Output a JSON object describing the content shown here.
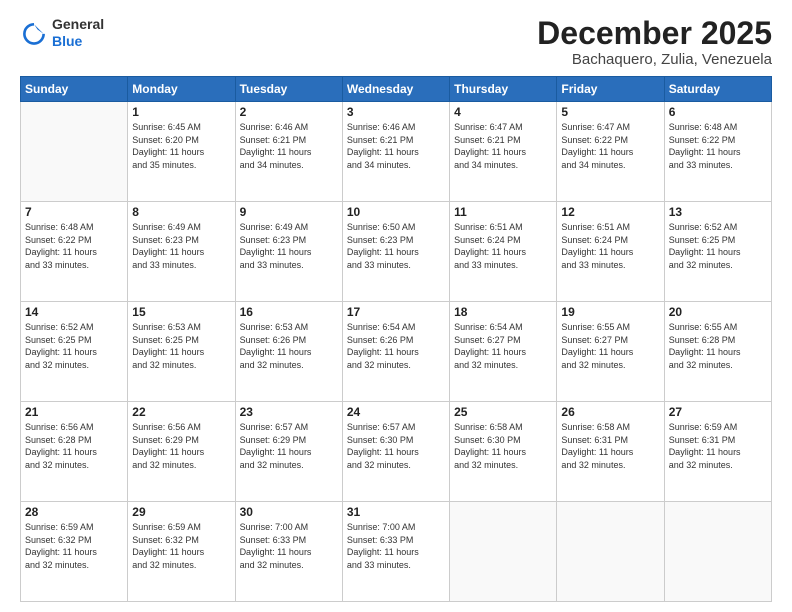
{
  "logo": {
    "general": "General",
    "blue": "Blue"
  },
  "header": {
    "month": "December 2025",
    "location": "Bachaquero, Zulia, Venezuela"
  },
  "weekdays": [
    "Sunday",
    "Monday",
    "Tuesday",
    "Wednesday",
    "Thursday",
    "Friday",
    "Saturday"
  ],
  "weeks": [
    [
      {
        "day": "",
        "text": ""
      },
      {
        "day": "1",
        "text": "Sunrise: 6:45 AM\nSunset: 6:20 PM\nDaylight: 11 hours\nand 35 minutes."
      },
      {
        "day": "2",
        "text": "Sunrise: 6:46 AM\nSunset: 6:21 PM\nDaylight: 11 hours\nand 34 minutes."
      },
      {
        "day": "3",
        "text": "Sunrise: 6:46 AM\nSunset: 6:21 PM\nDaylight: 11 hours\nand 34 minutes."
      },
      {
        "day": "4",
        "text": "Sunrise: 6:47 AM\nSunset: 6:21 PM\nDaylight: 11 hours\nand 34 minutes."
      },
      {
        "day": "5",
        "text": "Sunrise: 6:47 AM\nSunset: 6:22 PM\nDaylight: 11 hours\nand 34 minutes."
      },
      {
        "day": "6",
        "text": "Sunrise: 6:48 AM\nSunset: 6:22 PM\nDaylight: 11 hours\nand 33 minutes."
      }
    ],
    [
      {
        "day": "7",
        "text": "Sunrise: 6:48 AM\nSunset: 6:22 PM\nDaylight: 11 hours\nand 33 minutes."
      },
      {
        "day": "8",
        "text": "Sunrise: 6:49 AM\nSunset: 6:23 PM\nDaylight: 11 hours\nand 33 minutes."
      },
      {
        "day": "9",
        "text": "Sunrise: 6:49 AM\nSunset: 6:23 PM\nDaylight: 11 hours\nand 33 minutes."
      },
      {
        "day": "10",
        "text": "Sunrise: 6:50 AM\nSunset: 6:23 PM\nDaylight: 11 hours\nand 33 minutes."
      },
      {
        "day": "11",
        "text": "Sunrise: 6:51 AM\nSunset: 6:24 PM\nDaylight: 11 hours\nand 33 minutes."
      },
      {
        "day": "12",
        "text": "Sunrise: 6:51 AM\nSunset: 6:24 PM\nDaylight: 11 hours\nand 33 minutes."
      },
      {
        "day": "13",
        "text": "Sunrise: 6:52 AM\nSunset: 6:25 PM\nDaylight: 11 hours\nand 32 minutes."
      }
    ],
    [
      {
        "day": "14",
        "text": "Sunrise: 6:52 AM\nSunset: 6:25 PM\nDaylight: 11 hours\nand 32 minutes."
      },
      {
        "day": "15",
        "text": "Sunrise: 6:53 AM\nSunset: 6:25 PM\nDaylight: 11 hours\nand 32 minutes."
      },
      {
        "day": "16",
        "text": "Sunrise: 6:53 AM\nSunset: 6:26 PM\nDaylight: 11 hours\nand 32 minutes."
      },
      {
        "day": "17",
        "text": "Sunrise: 6:54 AM\nSunset: 6:26 PM\nDaylight: 11 hours\nand 32 minutes."
      },
      {
        "day": "18",
        "text": "Sunrise: 6:54 AM\nSunset: 6:27 PM\nDaylight: 11 hours\nand 32 minutes."
      },
      {
        "day": "19",
        "text": "Sunrise: 6:55 AM\nSunset: 6:27 PM\nDaylight: 11 hours\nand 32 minutes."
      },
      {
        "day": "20",
        "text": "Sunrise: 6:55 AM\nSunset: 6:28 PM\nDaylight: 11 hours\nand 32 minutes."
      }
    ],
    [
      {
        "day": "21",
        "text": "Sunrise: 6:56 AM\nSunset: 6:28 PM\nDaylight: 11 hours\nand 32 minutes."
      },
      {
        "day": "22",
        "text": "Sunrise: 6:56 AM\nSunset: 6:29 PM\nDaylight: 11 hours\nand 32 minutes."
      },
      {
        "day": "23",
        "text": "Sunrise: 6:57 AM\nSunset: 6:29 PM\nDaylight: 11 hours\nand 32 minutes."
      },
      {
        "day": "24",
        "text": "Sunrise: 6:57 AM\nSunset: 6:30 PM\nDaylight: 11 hours\nand 32 minutes."
      },
      {
        "day": "25",
        "text": "Sunrise: 6:58 AM\nSunset: 6:30 PM\nDaylight: 11 hours\nand 32 minutes."
      },
      {
        "day": "26",
        "text": "Sunrise: 6:58 AM\nSunset: 6:31 PM\nDaylight: 11 hours\nand 32 minutes."
      },
      {
        "day": "27",
        "text": "Sunrise: 6:59 AM\nSunset: 6:31 PM\nDaylight: 11 hours\nand 32 minutes."
      }
    ],
    [
      {
        "day": "28",
        "text": "Sunrise: 6:59 AM\nSunset: 6:32 PM\nDaylight: 11 hours\nand 32 minutes."
      },
      {
        "day": "29",
        "text": "Sunrise: 6:59 AM\nSunset: 6:32 PM\nDaylight: 11 hours\nand 32 minutes."
      },
      {
        "day": "30",
        "text": "Sunrise: 7:00 AM\nSunset: 6:33 PM\nDaylight: 11 hours\nand 32 minutes."
      },
      {
        "day": "31",
        "text": "Sunrise: 7:00 AM\nSunset: 6:33 PM\nDaylight: 11 hours\nand 33 minutes."
      },
      {
        "day": "",
        "text": ""
      },
      {
        "day": "",
        "text": ""
      },
      {
        "day": "",
        "text": ""
      }
    ]
  ]
}
